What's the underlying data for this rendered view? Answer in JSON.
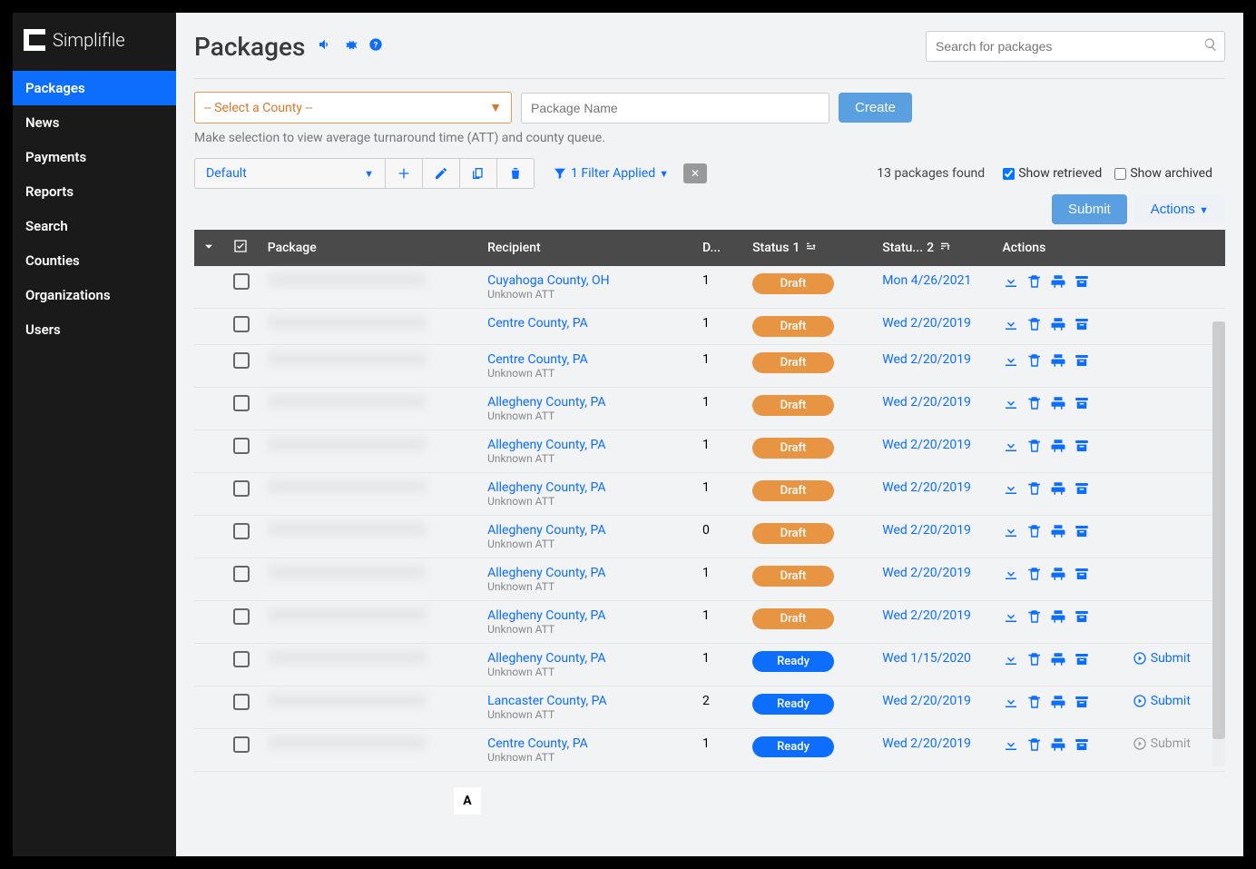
{
  "brand": "Simplifile",
  "nav": [
    "Packages",
    "News",
    "Payments",
    "Reports",
    "Search",
    "Counties",
    "Organizations",
    "Users"
  ],
  "nav_active": 0,
  "page_title": "Packages",
  "search_placeholder": "Search for packages",
  "county_select_placeholder": "-- Select a County --",
  "pkg_name_placeholder": "Package Name",
  "create_label": "Create",
  "hint": "Make selection to view average turnaround time (ATT) and county queue.",
  "default_dd": "Default",
  "filter_label": "1 Filter Applied",
  "found_label": "13 packages found",
  "show_retrieved_label": "Show retrieved",
  "show_retrieved_checked": true,
  "show_archived_label": "Show archived",
  "show_archived_checked": false,
  "submit_label": "Submit",
  "actions_label": "Actions",
  "columns": {
    "package": "Package",
    "recipient": "Recipient",
    "d": "D...",
    "status": "Status",
    "status_sort": "1",
    "status_date": "Statu...",
    "status_date_sort": "2",
    "actions": "Actions"
  },
  "unknown_att": "Unknown ATT",
  "rows": [
    {
      "recipient": "Cuyahoga County, OH",
      "d": "1",
      "status": "Draft",
      "date": "Mon 4/26/2021",
      "submit": null
    },
    {
      "recipient": "Centre County, PA",
      "d": "1",
      "status": "Draft",
      "date": "Wed 2/20/2019",
      "submit": null,
      "no_att": true
    },
    {
      "recipient": "Centre County, PA",
      "d": "1",
      "status": "Draft",
      "date": "Wed 2/20/2019",
      "submit": null
    },
    {
      "recipient": "Allegheny County, PA",
      "d": "1",
      "status": "Draft",
      "date": "Wed 2/20/2019",
      "submit": null
    },
    {
      "recipient": "Allegheny County, PA",
      "d": "1",
      "status": "Draft",
      "date": "Wed 2/20/2019",
      "submit": null
    },
    {
      "recipient": "Allegheny County, PA",
      "d": "1",
      "status": "Draft",
      "date": "Wed 2/20/2019",
      "submit": null
    },
    {
      "recipient": "Allegheny County, PA",
      "d": "0",
      "status": "Draft",
      "date": "Wed 2/20/2019",
      "submit": null
    },
    {
      "recipient": "Allegheny County, PA",
      "d": "1",
      "status": "Draft",
      "date": "Wed 2/20/2019",
      "submit": null
    },
    {
      "recipient": "Allegheny County, PA",
      "d": "1",
      "status": "Draft",
      "date": "Wed 2/20/2019",
      "submit": null
    },
    {
      "recipient": "Allegheny County, PA",
      "d": "1",
      "status": "Ready",
      "date": "Wed 1/15/2020",
      "submit": "Submit"
    },
    {
      "recipient": "Lancaster County, PA",
      "d": "2",
      "status": "Ready",
      "date": "Wed 2/20/2019",
      "submit": "Submit"
    },
    {
      "recipient": "Centre County, PA",
      "d": "1",
      "status": "Ready",
      "date": "Wed 2/20/2019",
      "submit": "Submit",
      "submit_disabled": true
    }
  ],
  "badge_a": "A"
}
